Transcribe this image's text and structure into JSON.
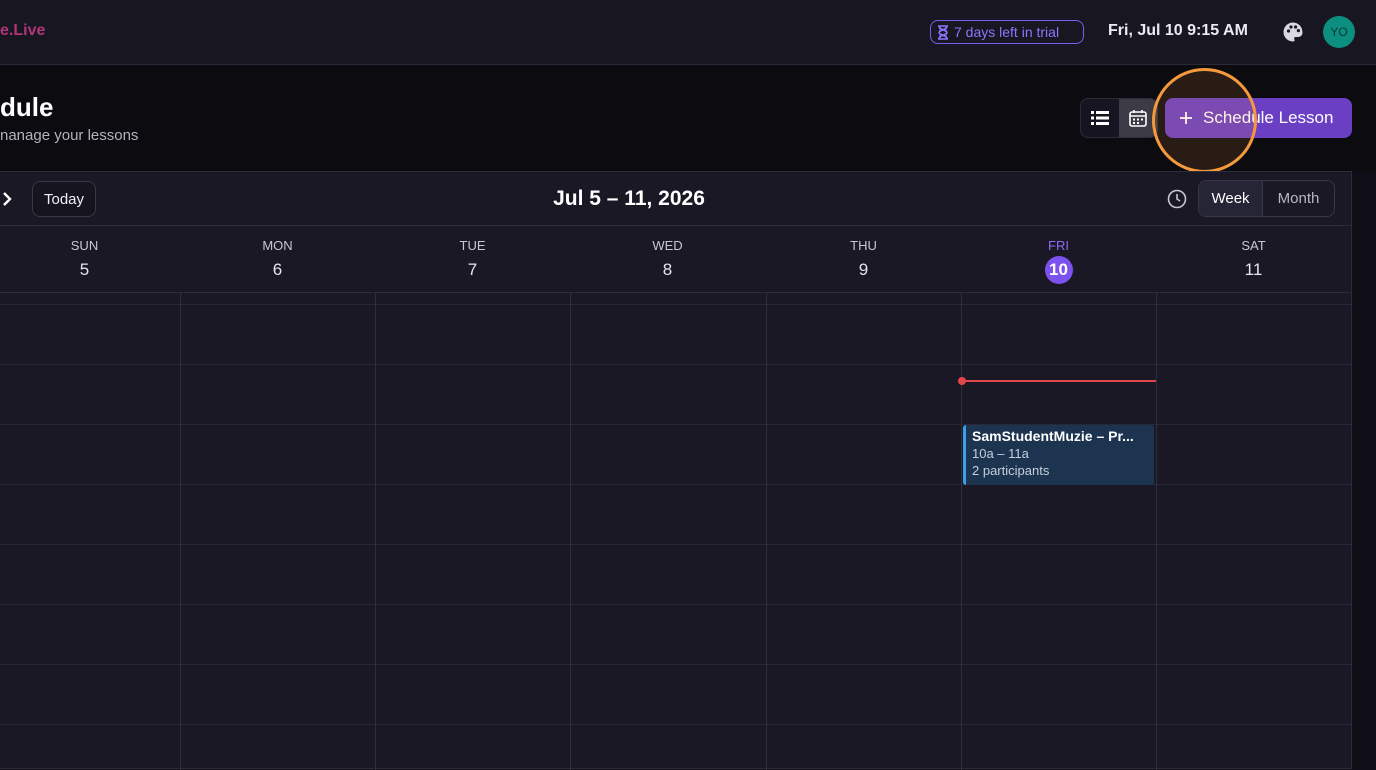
{
  "app": {
    "brand_fragment": "e.Live"
  },
  "topbar": {
    "trial_label": "7 days left in trial",
    "datetime": "Fri, Jul 10 9:15 AM",
    "theme_icon": "palette-icon",
    "avatar_initials": "YO",
    "accent_color": "#7b5cf0"
  },
  "page": {
    "title": "dule",
    "subtitle": "nanage your lessons",
    "schedule_button_label": "Schedule Lesson",
    "view_modes": [
      "list-view-icon",
      "calendar-view-icon"
    ]
  },
  "calendar": {
    "today_label": "Today",
    "range_title": "Jul 5 – 11, 2026",
    "range_modes": {
      "week": "Week",
      "month": "Month",
      "selected": "Week"
    },
    "days": [
      {
        "name": "SUN",
        "date": "5"
      },
      {
        "name": "MON",
        "date": "6"
      },
      {
        "name": "TUE",
        "date": "7"
      },
      {
        "name": "WED",
        "date": "8"
      },
      {
        "name": "THU",
        "date": "9"
      },
      {
        "name": "FRI",
        "date": "10",
        "today": true
      },
      {
        "name": "SAT",
        "date": "11"
      }
    ],
    "events": [
      {
        "title": "SamStudentMuzie – Pr...",
        "time": "10a – 11a",
        "participants": "2 participants",
        "day": "FRI",
        "color": "#3aa0e8"
      }
    ]
  }
}
